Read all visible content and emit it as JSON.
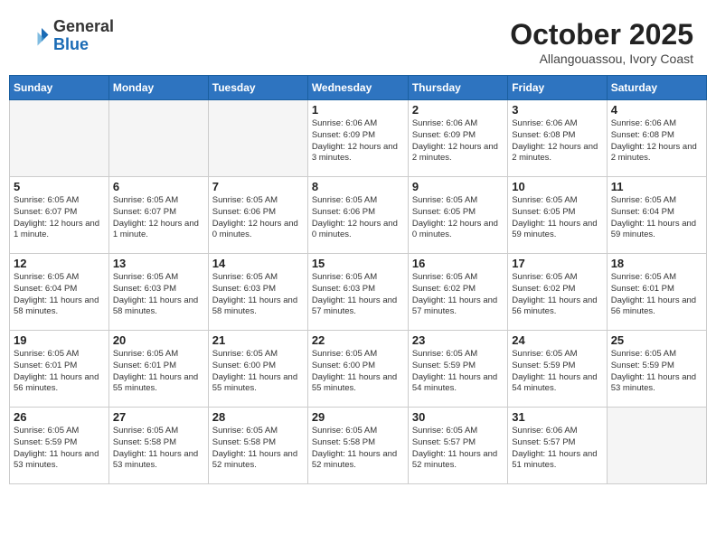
{
  "header": {
    "logo_general": "General",
    "logo_blue": "Blue",
    "month_title": "October 2025",
    "location": "Allangouassou, Ivory Coast"
  },
  "weekdays": [
    "Sunday",
    "Monday",
    "Tuesday",
    "Wednesday",
    "Thursday",
    "Friday",
    "Saturday"
  ],
  "weeks": [
    [
      {
        "day": "",
        "info": ""
      },
      {
        "day": "",
        "info": ""
      },
      {
        "day": "",
        "info": ""
      },
      {
        "day": "1",
        "info": "Sunrise: 6:06 AM\nSunset: 6:09 PM\nDaylight: 12 hours and 3 minutes."
      },
      {
        "day": "2",
        "info": "Sunrise: 6:06 AM\nSunset: 6:09 PM\nDaylight: 12 hours and 2 minutes."
      },
      {
        "day": "3",
        "info": "Sunrise: 6:06 AM\nSunset: 6:08 PM\nDaylight: 12 hours and 2 minutes."
      },
      {
        "day": "4",
        "info": "Sunrise: 6:06 AM\nSunset: 6:08 PM\nDaylight: 12 hours and 2 minutes."
      }
    ],
    [
      {
        "day": "5",
        "info": "Sunrise: 6:05 AM\nSunset: 6:07 PM\nDaylight: 12 hours and 1 minute."
      },
      {
        "day": "6",
        "info": "Sunrise: 6:05 AM\nSunset: 6:07 PM\nDaylight: 12 hours and 1 minute."
      },
      {
        "day": "7",
        "info": "Sunrise: 6:05 AM\nSunset: 6:06 PM\nDaylight: 12 hours and 0 minutes."
      },
      {
        "day": "8",
        "info": "Sunrise: 6:05 AM\nSunset: 6:06 PM\nDaylight: 12 hours and 0 minutes."
      },
      {
        "day": "9",
        "info": "Sunrise: 6:05 AM\nSunset: 6:05 PM\nDaylight: 12 hours and 0 minutes."
      },
      {
        "day": "10",
        "info": "Sunrise: 6:05 AM\nSunset: 6:05 PM\nDaylight: 11 hours and 59 minutes."
      },
      {
        "day": "11",
        "info": "Sunrise: 6:05 AM\nSunset: 6:04 PM\nDaylight: 11 hours and 59 minutes."
      }
    ],
    [
      {
        "day": "12",
        "info": "Sunrise: 6:05 AM\nSunset: 6:04 PM\nDaylight: 11 hours and 58 minutes."
      },
      {
        "day": "13",
        "info": "Sunrise: 6:05 AM\nSunset: 6:03 PM\nDaylight: 11 hours and 58 minutes."
      },
      {
        "day": "14",
        "info": "Sunrise: 6:05 AM\nSunset: 6:03 PM\nDaylight: 11 hours and 58 minutes."
      },
      {
        "day": "15",
        "info": "Sunrise: 6:05 AM\nSunset: 6:03 PM\nDaylight: 11 hours and 57 minutes."
      },
      {
        "day": "16",
        "info": "Sunrise: 6:05 AM\nSunset: 6:02 PM\nDaylight: 11 hours and 57 minutes."
      },
      {
        "day": "17",
        "info": "Sunrise: 6:05 AM\nSunset: 6:02 PM\nDaylight: 11 hours and 56 minutes."
      },
      {
        "day": "18",
        "info": "Sunrise: 6:05 AM\nSunset: 6:01 PM\nDaylight: 11 hours and 56 minutes."
      }
    ],
    [
      {
        "day": "19",
        "info": "Sunrise: 6:05 AM\nSunset: 6:01 PM\nDaylight: 11 hours and 56 minutes."
      },
      {
        "day": "20",
        "info": "Sunrise: 6:05 AM\nSunset: 6:01 PM\nDaylight: 11 hours and 55 minutes."
      },
      {
        "day": "21",
        "info": "Sunrise: 6:05 AM\nSunset: 6:00 PM\nDaylight: 11 hours and 55 minutes."
      },
      {
        "day": "22",
        "info": "Sunrise: 6:05 AM\nSunset: 6:00 PM\nDaylight: 11 hours and 55 minutes."
      },
      {
        "day": "23",
        "info": "Sunrise: 6:05 AM\nSunset: 5:59 PM\nDaylight: 11 hours and 54 minutes."
      },
      {
        "day": "24",
        "info": "Sunrise: 6:05 AM\nSunset: 5:59 PM\nDaylight: 11 hours and 54 minutes."
      },
      {
        "day": "25",
        "info": "Sunrise: 6:05 AM\nSunset: 5:59 PM\nDaylight: 11 hours and 53 minutes."
      }
    ],
    [
      {
        "day": "26",
        "info": "Sunrise: 6:05 AM\nSunset: 5:59 PM\nDaylight: 11 hours and 53 minutes."
      },
      {
        "day": "27",
        "info": "Sunrise: 6:05 AM\nSunset: 5:58 PM\nDaylight: 11 hours and 53 minutes."
      },
      {
        "day": "28",
        "info": "Sunrise: 6:05 AM\nSunset: 5:58 PM\nDaylight: 11 hours and 52 minutes."
      },
      {
        "day": "29",
        "info": "Sunrise: 6:05 AM\nSunset: 5:58 PM\nDaylight: 11 hours and 52 minutes."
      },
      {
        "day": "30",
        "info": "Sunrise: 6:05 AM\nSunset: 5:57 PM\nDaylight: 11 hours and 52 minutes."
      },
      {
        "day": "31",
        "info": "Sunrise: 6:06 AM\nSunset: 5:57 PM\nDaylight: 11 hours and 51 minutes."
      },
      {
        "day": "",
        "info": ""
      }
    ]
  ]
}
